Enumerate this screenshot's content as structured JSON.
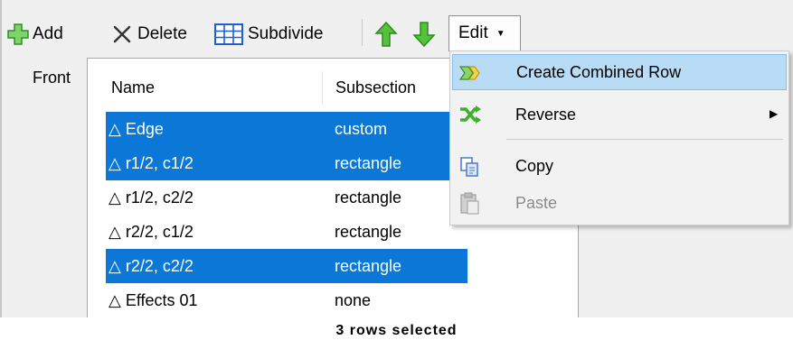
{
  "toolbar": {
    "add_label": "Add",
    "delete_label": "Delete",
    "subdivide_label": "Subdivide",
    "edit_label": "Edit",
    "icons": {
      "add": "plus-icon",
      "delete": "x-icon",
      "subdivide": "grid-icon",
      "move_up": "arrow-up-icon",
      "move_down": "arrow-down-icon",
      "edit_caret": "chevron-down-icon"
    }
  },
  "side_label": "Front",
  "grid": {
    "columns": [
      "Name",
      "Subsection"
    ],
    "rows": [
      {
        "name": "△ Edge",
        "subsection": "custom",
        "selected": true
      },
      {
        "name": "△ r1/2, c1/2",
        "subsection": "rectangle",
        "selected": true
      },
      {
        "name": "△ r1/2, c2/2",
        "subsection": "rectangle",
        "selected": false
      },
      {
        "name": "△ r2/2, c1/2",
        "subsection": "rectangle",
        "selected": false
      },
      {
        "name": "△ r2/2, c2/2",
        "subsection": "rectangle",
        "selected": true
      },
      {
        "name": "△ Effects 01",
        "subsection": "none",
        "selected": false
      }
    ]
  },
  "edit_menu": {
    "items": [
      {
        "label": "Create Combined Row",
        "icon": "combine-rows-icon",
        "highlighted": true,
        "enabled": true
      },
      {
        "label": "Reverse",
        "icon": "reverse-icon",
        "submenu": true,
        "enabled": true
      },
      {
        "label": "Copy",
        "icon": "copy-icon",
        "enabled": true
      },
      {
        "label": "Paste",
        "icon": "paste-icon",
        "enabled": false
      }
    ]
  },
  "status": "3 rows selected",
  "colors": {
    "selection": "#0b78d7",
    "menu_highlight": "#b9dcf6",
    "green_icon": "#3fae2a"
  }
}
